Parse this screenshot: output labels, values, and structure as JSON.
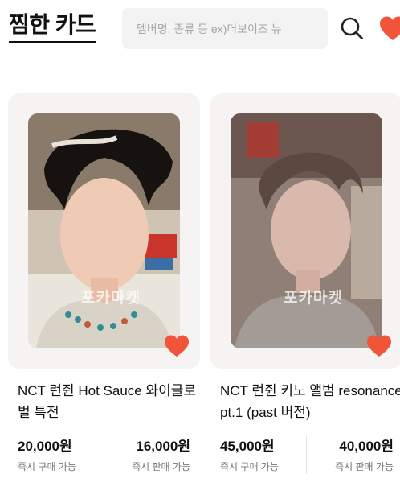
{
  "header": {
    "title": "찜한 카드",
    "search_placeholder": "멤버명, 종류 등 ex)더보이즈 뉴"
  },
  "icons": {
    "search": "search-icon",
    "heart": "heart-icon",
    "accent": "#f0553a"
  },
  "cards": [
    {
      "title": "NCT 런쥔 Hot Sauce 와이글로벌 특전",
      "watermark": "포카마켓",
      "buy_price": "20,000원",
      "buy_label": "즉시 구매 가능",
      "sell_price": "16,000원",
      "sell_label": "즉시 판매 가능"
    },
    {
      "title": "NCT 런쥔 키노 앨범 resonance pt.1 (past 버전)",
      "watermark": "포카마켓",
      "buy_price": "45,000원",
      "buy_label": "즉시 구매 가능",
      "sell_price": "40,000원",
      "sell_label": "즉시 판매 가능"
    }
  ]
}
